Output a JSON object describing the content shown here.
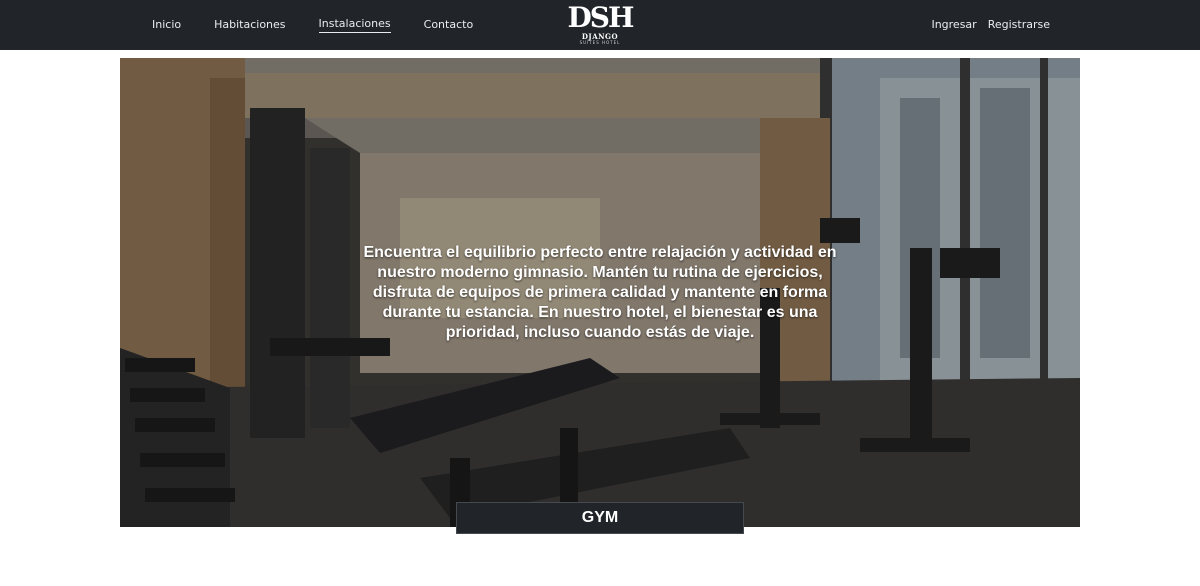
{
  "navbar": {
    "links": [
      "Inicio",
      "Habitaciones",
      "Instalaciones",
      "Contacto"
    ],
    "active": "Instalaciones",
    "auth": {
      "login": "Ingresar",
      "register": "Registrarse"
    },
    "logo": {
      "mark": "DSH",
      "name": "DJANGO",
      "tagline": "SUITES HOTEL"
    }
  },
  "hero": {
    "description": "Encuentra el equilibrio perfecto entre relajación y actividad en nuestro moderno gimnasio. Mantén tu rutina de ejercicios, disfruta de equipos de primera calidad y mantente en forma durante tu estancia. En nuestro hotel, el bienestar es una prioridad, incluso cuando estás de viaje.",
    "label": "GYM"
  },
  "colors": {
    "navbar": "#212529",
    "label_bg": "#212529",
    "text": "#ffffff"
  }
}
